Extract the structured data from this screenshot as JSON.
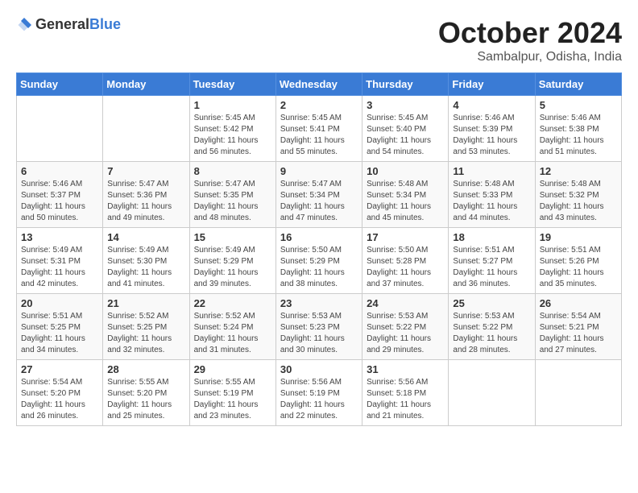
{
  "header": {
    "logo_general": "General",
    "logo_blue": "Blue",
    "month_title": "October 2024",
    "location": "Sambalpur, Odisha, India"
  },
  "weekdays": [
    "Sunday",
    "Monday",
    "Tuesday",
    "Wednesday",
    "Thursday",
    "Friday",
    "Saturday"
  ],
  "weeks": [
    [
      {
        "day": null,
        "info": null
      },
      {
        "day": null,
        "info": null
      },
      {
        "day": "1",
        "info": "Sunrise: 5:45 AM\nSunset: 5:42 PM\nDaylight: 11 hours\nand 56 minutes."
      },
      {
        "day": "2",
        "info": "Sunrise: 5:45 AM\nSunset: 5:41 PM\nDaylight: 11 hours\nand 55 minutes."
      },
      {
        "day": "3",
        "info": "Sunrise: 5:45 AM\nSunset: 5:40 PM\nDaylight: 11 hours\nand 54 minutes."
      },
      {
        "day": "4",
        "info": "Sunrise: 5:46 AM\nSunset: 5:39 PM\nDaylight: 11 hours\nand 53 minutes."
      },
      {
        "day": "5",
        "info": "Sunrise: 5:46 AM\nSunset: 5:38 PM\nDaylight: 11 hours\nand 51 minutes."
      }
    ],
    [
      {
        "day": "6",
        "info": "Sunrise: 5:46 AM\nSunset: 5:37 PM\nDaylight: 11 hours\nand 50 minutes."
      },
      {
        "day": "7",
        "info": "Sunrise: 5:47 AM\nSunset: 5:36 PM\nDaylight: 11 hours\nand 49 minutes."
      },
      {
        "day": "8",
        "info": "Sunrise: 5:47 AM\nSunset: 5:35 PM\nDaylight: 11 hours\nand 48 minutes."
      },
      {
        "day": "9",
        "info": "Sunrise: 5:47 AM\nSunset: 5:34 PM\nDaylight: 11 hours\nand 47 minutes."
      },
      {
        "day": "10",
        "info": "Sunrise: 5:48 AM\nSunset: 5:34 PM\nDaylight: 11 hours\nand 45 minutes."
      },
      {
        "day": "11",
        "info": "Sunrise: 5:48 AM\nSunset: 5:33 PM\nDaylight: 11 hours\nand 44 minutes."
      },
      {
        "day": "12",
        "info": "Sunrise: 5:48 AM\nSunset: 5:32 PM\nDaylight: 11 hours\nand 43 minutes."
      }
    ],
    [
      {
        "day": "13",
        "info": "Sunrise: 5:49 AM\nSunset: 5:31 PM\nDaylight: 11 hours\nand 42 minutes."
      },
      {
        "day": "14",
        "info": "Sunrise: 5:49 AM\nSunset: 5:30 PM\nDaylight: 11 hours\nand 41 minutes."
      },
      {
        "day": "15",
        "info": "Sunrise: 5:49 AM\nSunset: 5:29 PM\nDaylight: 11 hours\nand 39 minutes."
      },
      {
        "day": "16",
        "info": "Sunrise: 5:50 AM\nSunset: 5:29 PM\nDaylight: 11 hours\nand 38 minutes."
      },
      {
        "day": "17",
        "info": "Sunrise: 5:50 AM\nSunset: 5:28 PM\nDaylight: 11 hours\nand 37 minutes."
      },
      {
        "day": "18",
        "info": "Sunrise: 5:51 AM\nSunset: 5:27 PM\nDaylight: 11 hours\nand 36 minutes."
      },
      {
        "day": "19",
        "info": "Sunrise: 5:51 AM\nSunset: 5:26 PM\nDaylight: 11 hours\nand 35 minutes."
      }
    ],
    [
      {
        "day": "20",
        "info": "Sunrise: 5:51 AM\nSunset: 5:25 PM\nDaylight: 11 hours\nand 34 minutes."
      },
      {
        "day": "21",
        "info": "Sunrise: 5:52 AM\nSunset: 5:25 PM\nDaylight: 11 hours\nand 32 minutes."
      },
      {
        "day": "22",
        "info": "Sunrise: 5:52 AM\nSunset: 5:24 PM\nDaylight: 11 hours\nand 31 minutes."
      },
      {
        "day": "23",
        "info": "Sunrise: 5:53 AM\nSunset: 5:23 PM\nDaylight: 11 hours\nand 30 minutes."
      },
      {
        "day": "24",
        "info": "Sunrise: 5:53 AM\nSunset: 5:22 PM\nDaylight: 11 hours\nand 29 minutes."
      },
      {
        "day": "25",
        "info": "Sunrise: 5:53 AM\nSunset: 5:22 PM\nDaylight: 11 hours\nand 28 minutes."
      },
      {
        "day": "26",
        "info": "Sunrise: 5:54 AM\nSunset: 5:21 PM\nDaylight: 11 hours\nand 27 minutes."
      }
    ],
    [
      {
        "day": "27",
        "info": "Sunrise: 5:54 AM\nSunset: 5:20 PM\nDaylight: 11 hours\nand 26 minutes."
      },
      {
        "day": "28",
        "info": "Sunrise: 5:55 AM\nSunset: 5:20 PM\nDaylight: 11 hours\nand 25 minutes."
      },
      {
        "day": "29",
        "info": "Sunrise: 5:55 AM\nSunset: 5:19 PM\nDaylight: 11 hours\nand 23 minutes."
      },
      {
        "day": "30",
        "info": "Sunrise: 5:56 AM\nSunset: 5:19 PM\nDaylight: 11 hours\nand 22 minutes."
      },
      {
        "day": "31",
        "info": "Sunrise: 5:56 AM\nSunset: 5:18 PM\nDaylight: 11 hours\nand 21 minutes."
      },
      {
        "day": null,
        "info": null
      },
      {
        "day": null,
        "info": null
      }
    ]
  ]
}
